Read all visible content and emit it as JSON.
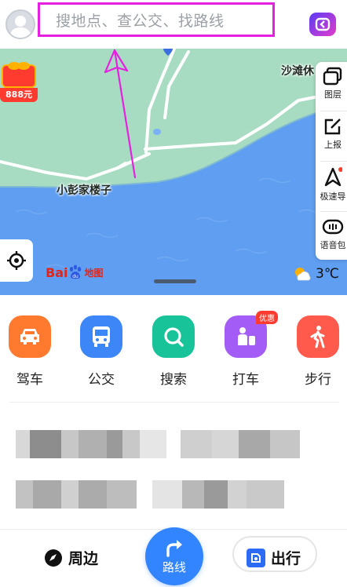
{
  "search": {
    "placeholder": "搜地点、查公交、找路线"
  },
  "map": {
    "labels": {
      "area_right": "沙滩休",
      "village": "小彭家楼子"
    },
    "promo_amount": "888元",
    "logo_bai": "Bai",
    "logo_ditu": "地图",
    "weather": {
      "temp": "3℃",
      "icon": "partly-cloudy-icon"
    }
  },
  "side_panel": {
    "items": [
      {
        "label": "图层",
        "icon": "layers-icon"
      },
      {
        "label": "上报",
        "icon": "report-icon"
      },
      {
        "label": "极速导",
        "icon": "navigation-icon"
      },
      {
        "label": "语音包",
        "icon": "voice-pack-icon"
      }
    ]
  },
  "quick_actions": [
    {
      "label": "驾车",
      "color": "#ff7a2e",
      "icon": "car-icon"
    },
    {
      "label": "公交",
      "color": "#3c86f7",
      "icon": "bus-icon"
    },
    {
      "label": "搜索",
      "color": "#19c39a",
      "icon": "search-icon"
    },
    {
      "label": "打车",
      "color": "#a35cf5",
      "icon": "taxi-icon",
      "badge": "优惠"
    },
    {
      "label": "步行",
      "color": "#ff5a4b",
      "icon": "walk-icon"
    }
  ],
  "bottom_nav": {
    "nearby": "周边",
    "route": "路线",
    "go": "出行"
  },
  "colors": {
    "accent": "#3385ff",
    "search_border": "#e620e0",
    "annotation_arrow": "#e620e0"
  }
}
